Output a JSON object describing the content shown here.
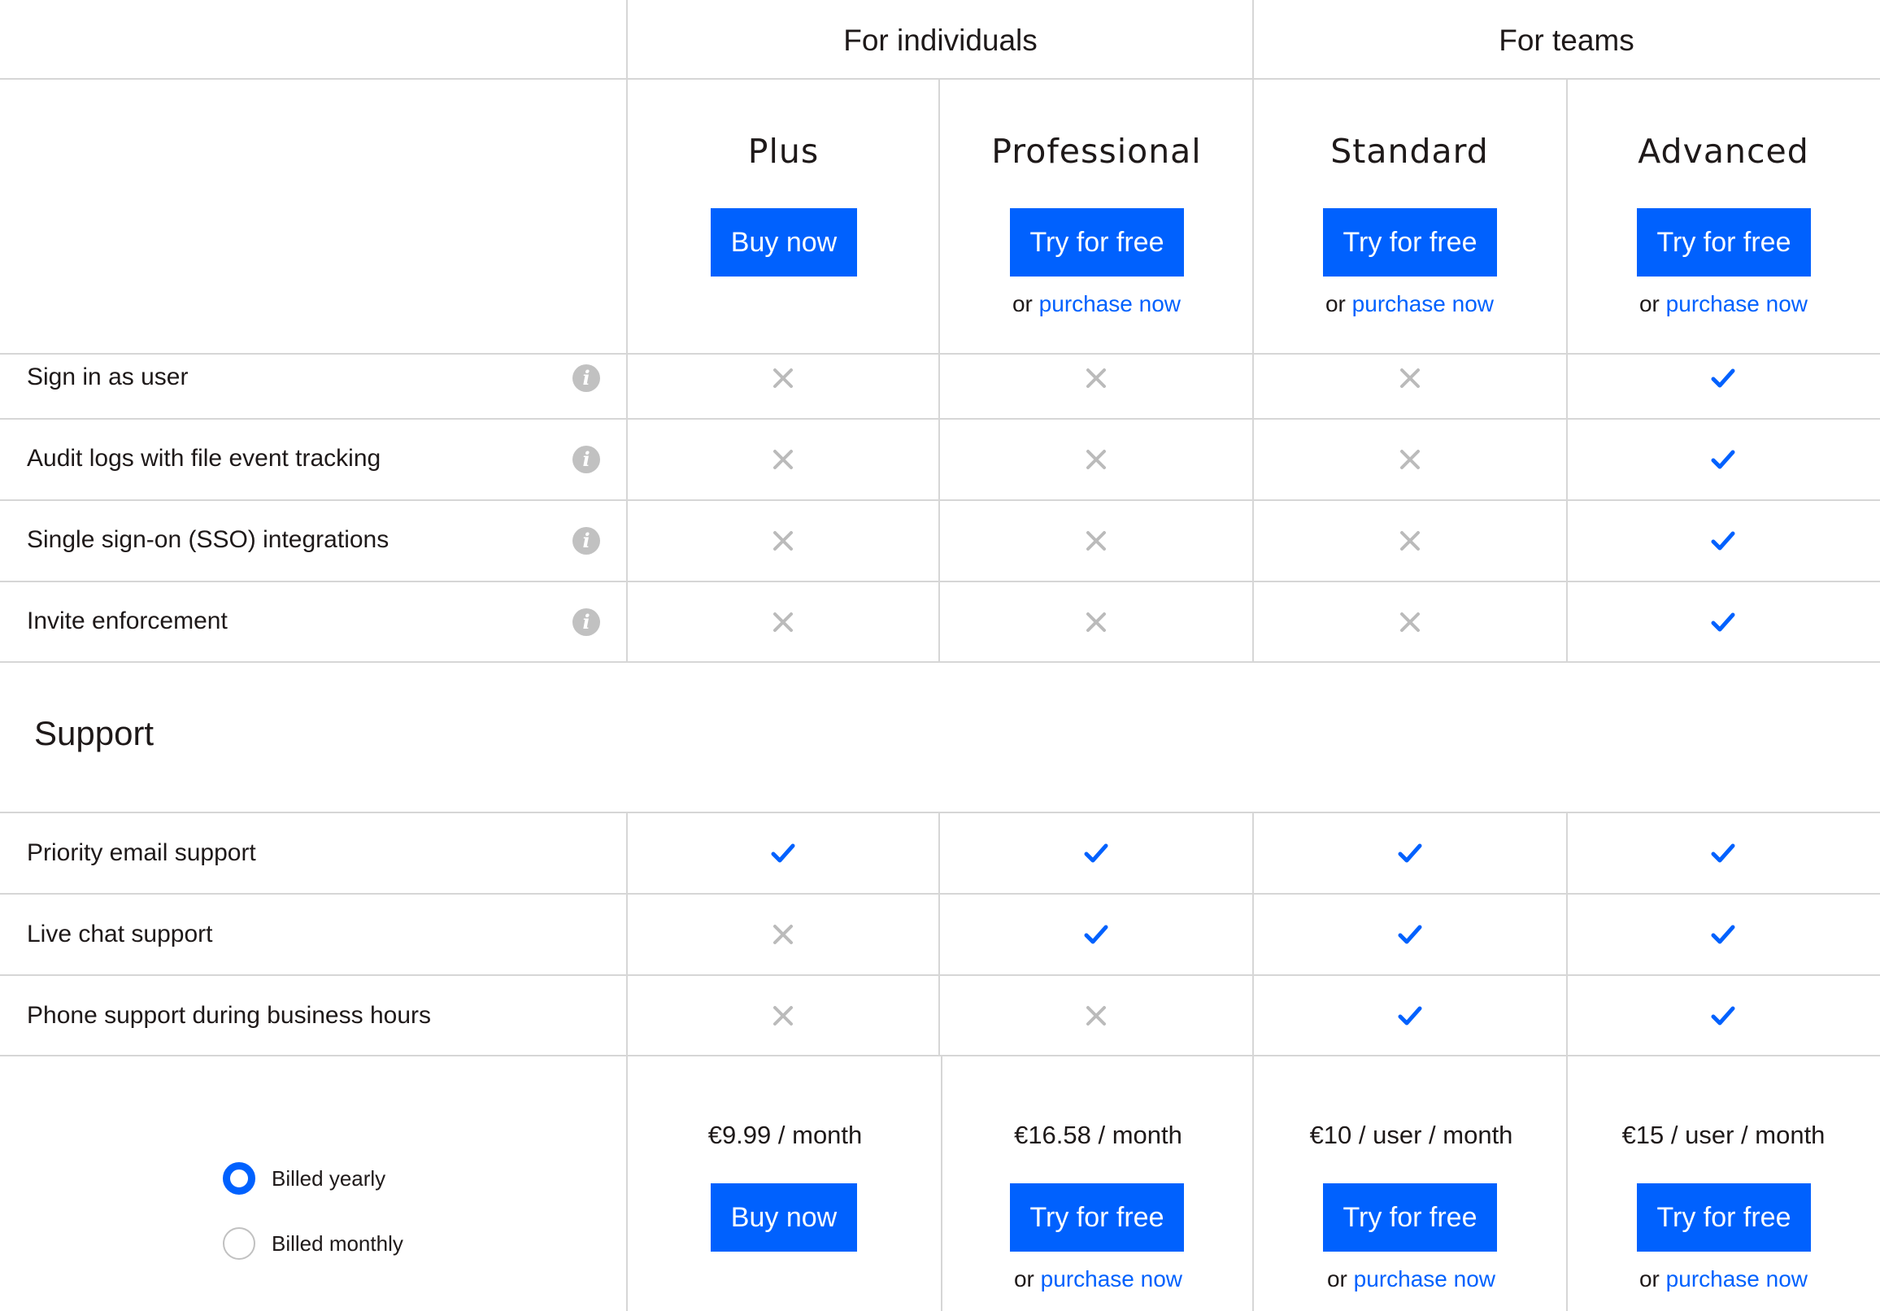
{
  "groups": {
    "individuals": "For individuals",
    "teams": "For teams"
  },
  "plans": [
    {
      "name": "Plus",
      "cta": "Buy now",
      "alt_prefix": "",
      "alt_link": "",
      "price": "€9.99 / month"
    },
    {
      "name": "Professional",
      "cta": "Try for free",
      "alt_prefix": "or ",
      "alt_link": "purchase now",
      "price": "€16.58 / month"
    },
    {
      "name": "Standard",
      "cta": "Try for free",
      "alt_prefix": "or ",
      "alt_link": "purchase now",
      "price": "€10 / user / month"
    },
    {
      "name": "Advanced",
      "cta": "Try for free",
      "alt_prefix": "or ",
      "alt_link": "purchase now",
      "price": "€15 / user / month"
    }
  ],
  "admin_features": [
    {
      "label": "Sign in as user",
      "info": true,
      "values": [
        false,
        false,
        false,
        true
      ]
    },
    {
      "label": "Audit logs with file event tracking",
      "info": true,
      "values": [
        false,
        false,
        false,
        true
      ]
    },
    {
      "label": "Single sign-on (SSO) integrations",
      "info": true,
      "values": [
        false,
        false,
        false,
        true
      ]
    },
    {
      "label": "Invite enforcement",
      "info": true,
      "values": [
        false,
        false,
        false,
        true
      ]
    }
  ],
  "support": {
    "title": "Support",
    "features": [
      {
        "label": "Priority email support",
        "values": [
          true,
          true,
          true,
          true
        ]
      },
      {
        "label": "Live chat support",
        "values": [
          false,
          true,
          true,
          true
        ]
      },
      {
        "label": "Phone support during business hours",
        "values": [
          false,
          false,
          true,
          true
        ]
      }
    ]
  },
  "billing": {
    "options": [
      "Billed yearly",
      "Billed monthly"
    ],
    "selected": "Billed yearly"
  },
  "icons": {
    "info": "info-icon",
    "included": "check-icon",
    "excluded": "cross-icon"
  },
  "colors": {
    "accent": "#0061fe",
    "check": "#0061fe",
    "cross": "#bbbbbb",
    "info_icon": "#c1c1c1",
    "divider": "#d6d6d6"
  }
}
